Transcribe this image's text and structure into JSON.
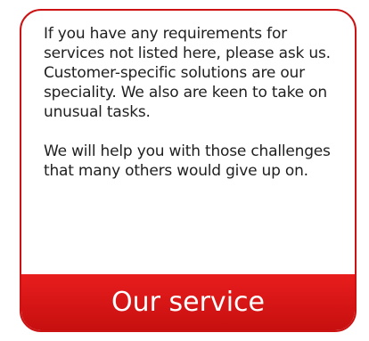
{
  "card": {
    "paragraphs": [
      "If you have any requirements for services not listed here, please ask us. Customer-specific solutions are our speciality. We also are keen to take on unusual tasks.",
      "We will help you with those challenges that many others would give up on."
    ],
    "footer_title": "Our service"
  },
  "colors": {
    "accent": "#cc1212",
    "footer_top": "#e81d1d",
    "footer_bottom": "#c70f0f",
    "text": "#1f1f1f",
    "footer_text": "#ffffff"
  }
}
